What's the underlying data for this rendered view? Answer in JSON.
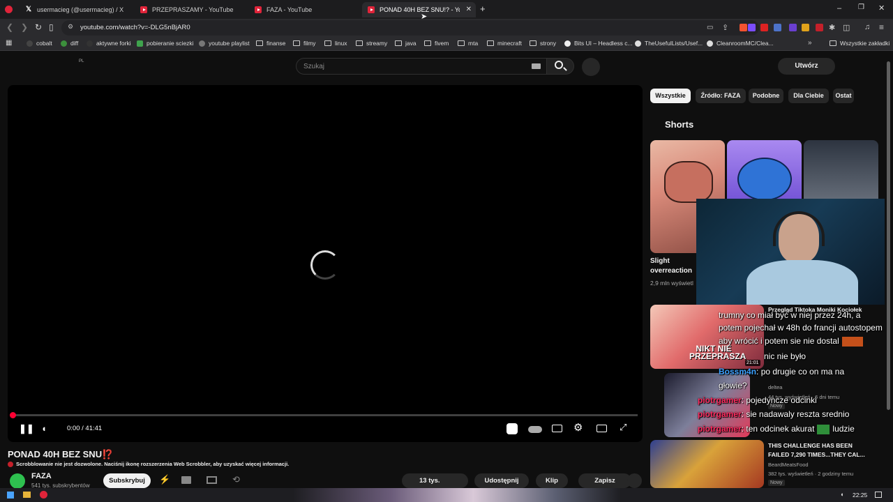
{
  "tabs": [
    {
      "title": "usermacieg (@usermacieg) / X"
    },
    {
      "title": "PRZEPRASZAMY - YouTube"
    },
    {
      "title": "FAZA - YouTube"
    },
    {
      "title": "PONAD 40H BEZ SNU!? - YouTube"
    }
  ],
  "address_bar": {
    "url": "youtube.com/watch?v=-DLG5nBjAR0"
  },
  "bookmarks": [
    {
      "label": "cobalt"
    },
    {
      "label": "diff"
    },
    {
      "label": "aktywne forki"
    },
    {
      "label": "pobieranie sciezki"
    },
    {
      "label": "youtube playlist"
    },
    {
      "label": "finanse"
    },
    {
      "label": "filmy"
    },
    {
      "label": "linux"
    },
    {
      "label": "streamy"
    },
    {
      "label": "java"
    },
    {
      "label": "fivem"
    },
    {
      "label": "mta"
    },
    {
      "label": "minecraft"
    },
    {
      "label": "strony"
    },
    {
      "label": "Bits UI – Headless c..."
    },
    {
      "label": "TheUsefulLists/Usef..."
    },
    {
      "label": "CleanroomMC/Clea..."
    }
  ],
  "bookmarks_all": "Wszystkie zakładki",
  "header": {
    "country": "PL",
    "search_placeholder": "Szukaj",
    "create_label": "Utwórz"
  },
  "player": {
    "time": "0:00 / 41:41",
    "progress": 0.0
  },
  "video": {
    "title": "PONAD 40H BEZ SNU",
    "title_emoji": "⁉️",
    "scrobbler_notice": "Scrobblowanie nie jest dozwolone. Naciśnij ikonę rozszerzenia Web Scrobbler, aby uzyskać więcej informacji.",
    "channel": "FAZA",
    "subscribers": "541 tys. subskrybentów",
    "subscribe_label": "Subskrybuj",
    "likes": "13 tys.",
    "share_label": "Udostępnij",
    "clip_label": "Klip",
    "save_label": "Zapisz"
  },
  "chips": [
    "Wszystkie",
    "Źródło: FAZA",
    "Podobne",
    "Dla Ciebie",
    "Ostat"
  ],
  "shorts": {
    "heading": "Shorts",
    "items": [
      {
        "title_line1": "Slight",
        "title_line2": "overreaction",
        "views": "2,9 mln wyświetl"
      }
    ]
  },
  "related": [
    {
      "title": "Przegląd Tiktoka Moniki Kociołek",
      "channel": "",
      "meta": "",
      "duration": "21:01",
      "thumb_text": "NIKT NIE PRZEPRASZA"
    },
    {
      "title": "",
      "channel": "deltea",
      "meta": "44 tys. wyświetleń · 6 dni temu",
      "badge": "Nowy",
      "duration": ""
    },
    {
      "title_line1": "THIS CHALLENGE HAS BEEN",
      "title_line2": "FAILED 7,290 TIMES...THEY CAL...",
      "channel": "BeardMeatsFood",
      "meta": "382 tys. wyświetleń · 2 godziny temu",
      "badge": "Nowy"
    }
  ],
  "chat": [
    {
      "user": "",
      "text": "trumny co miał być w niej przez 24h, a"
    },
    {
      "user": "",
      "text": "potem pojechał w 48h do francji autostopem"
    },
    {
      "user": "",
      "text": "aby wrócić i potem sie nie dostal"
    },
    {
      "user": "",
      "text": "nic nie było"
    },
    {
      "user": "Bossm4n",
      "text": ": po drugie co on ma na"
    },
    {
      "user": "",
      "text": "głowie?"
    },
    {
      "user": "piotrgamer",
      "text": ": pojedyncze odcinki"
    },
    {
      "user": "piotrgamer",
      "text": ": sie nadawaly reszta srednio"
    },
    {
      "user": "piotrgamer",
      "text": ": ten odcinek akurat"
    },
    {
      "user": "",
      "text": "ludzie"
    }
  ],
  "system": {
    "clock": "22:25"
  },
  "colors": {
    "accent": "#ff0033",
    "background": "#0f0f0f",
    "chat_user": "#ff2b60"
  }
}
